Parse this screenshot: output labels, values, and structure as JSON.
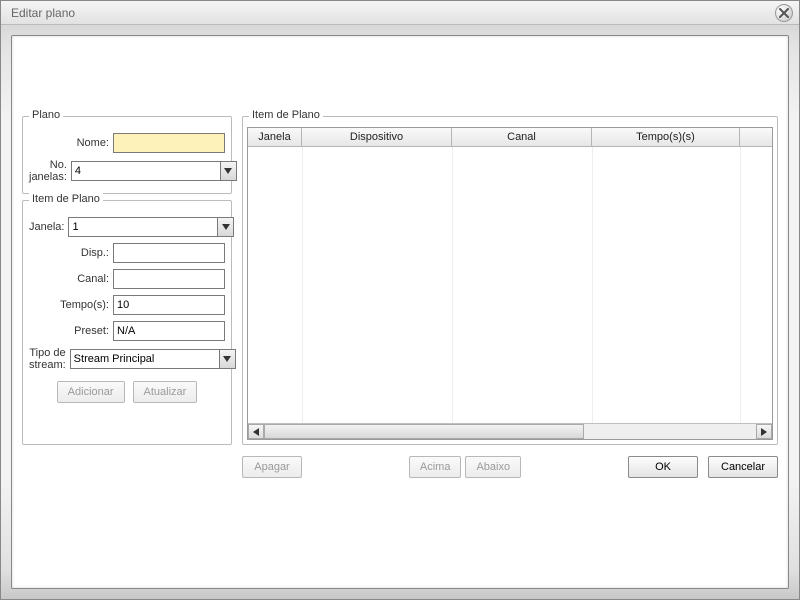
{
  "title": "Editar plano",
  "groups": {
    "plano": "Plano",
    "item": "Item de Plano",
    "tabela": "Item de Plano"
  },
  "labels": {
    "nome": "Nome:",
    "no_janelas": "No. janelas:",
    "janela": "Janela:",
    "disp": "Disp.:",
    "canal": "Canal:",
    "tempo": "Tempo(s):",
    "preset": "Preset:",
    "tipo_stream": "Tipo de stream:"
  },
  "values": {
    "nome": "",
    "no_janelas": "4",
    "janela": "1",
    "disp": "",
    "canal": "",
    "tempo": "10",
    "preset": "N/A",
    "tipo_stream": "Stream Principal"
  },
  "buttons": {
    "adicionar": "Adicionar",
    "atualizar": "Atualizar",
    "apagar": "Apagar",
    "acima": "Acima",
    "abaixo": "Abaixo",
    "ok": "OK",
    "cancelar": "Cancelar"
  },
  "table": {
    "headers": [
      "Janela",
      "Dispositivo",
      "Canal",
      "Tempo(s)(s)",
      ""
    ],
    "rows": []
  }
}
